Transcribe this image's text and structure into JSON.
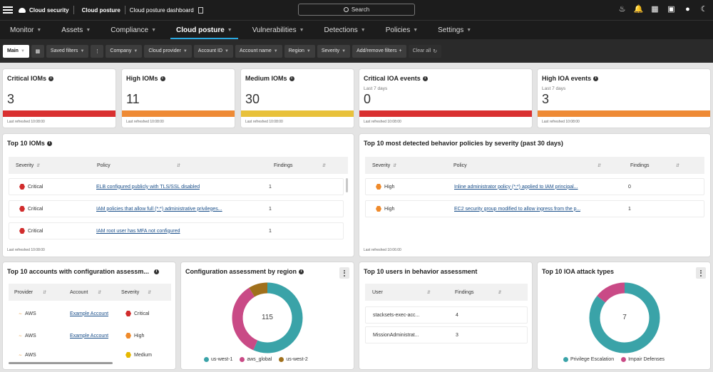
{
  "topbar": {
    "app": "Cloud security",
    "module": "Cloud posture",
    "page": "Cloud posture dashboard",
    "search_label": "Search"
  },
  "nav": {
    "tabs": [
      {
        "label": "Monitor"
      },
      {
        "label": "Assets"
      },
      {
        "label": "Compliance"
      },
      {
        "label": "Cloud posture"
      },
      {
        "label": "Vulnerabilities"
      },
      {
        "label": "Detections"
      },
      {
        "label": "Policies"
      },
      {
        "label": "Settings"
      }
    ]
  },
  "filters": {
    "view": "Main",
    "saved": "Saved filters",
    "items": [
      "Company",
      "Cloud provider",
      "Account ID",
      "Account name",
      "Region",
      "Severity"
    ],
    "add_remove": "Add/remove filters",
    "clear": "Clear all"
  },
  "kpis": [
    {
      "title": "Critical IOMs",
      "sub": "",
      "value": "3",
      "color": "#d93030",
      "refreshed": "Last refreshed 10:08:00"
    },
    {
      "title": "High IOMs",
      "sub": "",
      "value": "11",
      "color": "#ee8a35",
      "refreshed": "Last refreshed 10:08:00"
    },
    {
      "title": "Medium IOMs",
      "sub": "",
      "value": "30",
      "color": "#e8c13a",
      "refreshed": "Last refreshed 10:08:00"
    },
    {
      "title": "Critical IOA events",
      "sub": "Last 7 days",
      "value": "0",
      "color": "#d93030",
      "refreshed": "Last refreshed 10:08:00"
    },
    {
      "title": "High IOA events",
      "sub": "Last 7 days",
      "value": "3",
      "color": "#ee8a35",
      "refreshed": "Last refreshed 10:08:00"
    }
  ],
  "top_ioms": {
    "title": "Top 10 IOMs",
    "headers": {
      "severity": "Severity",
      "policy": "Policy",
      "findings": "Findings"
    },
    "rows": [
      {
        "severity": "Critical",
        "policy": "ELB configured publicly with TLS/SSL disabled",
        "findings": "1"
      },
      {
        "severity": "Critical",
        "policy": "IAM policies that allow full (*:*) administrative privileges...",
        "findings": "1"
      },
      {
        "severity": "Critical",
        "policy": "IAM root user has MFA not configured",
        "findings": "1"
      }
    ],
    "refreshed": "Last refreshed 10:08:00"
  },
  "top_behavior": {
    "title": "Top 10 most detected behavior policies by severity (past 30 days)",
    "headers": {
      "severity": "Severity",
      "policy": "Policy",
      "findings": "Findings"
    },
    "rows": [
      {
        "severity": "High",
        "policy": "Inline administrator policy (*:*) applied to IAM principal...",
        "findings": "0"
      },
      {
        "severity": "High",
        "policy": "EC2 security group modified to allow ingress from the p...",
        "findings": "1"
      }
    ],
    "refreshed": "Last refreshed 10:06:00"
  },
  "top_accounts": {
    "title": "Top 10 accounts with configuration assessm...",
    "headers": {
      "provider": "Provider",
      "account": "Account",
      "severity": "Severity"
    },
    "rows": [
      {
        "provider": "AWS",
        "account": "Example Account",
        "severity": "Critical"
      },
      {
        "provider": "AWS",
        "account": "Example Account",
        "severity": "High"
      },
      {
        "provider": "AWS",
        "account": "",
        "severity": "Medium"
      }
    ]
  },
  "region_chart": {
    "title": "Configuration assessment by region",
    "total": "115",
    "legend": [
      "us-west-1",
      "aws_global",
      "us-west-2"
    ],
    "colors": [
      "#3aa3a8",
      "#c94a86",
      "#a0701c"
    ]
  },
  "top_users": {
    "title": "Top 10 users in behavior assessment",
    "headers": {
      "user": "User",
      "findings": "Findings"
    },
    "rows": [
      {
        "user": "stacksets-exec-acc...",
        "findings": "4"
      },
      {
        "user": "MissionAdministrat...",
        "findings": "3"
      }
    ]
  },
  "ioa_chart": {
    "title": "Top 10 IOA attack types",
    "total": "7",
    "legend": [
      "Privilege Escalation",
      "Impair Defenses"
    ],
    "colors": [
      "#3aa3a8",
      "#c94a86"
    ]
  },
  "chart_data": [
    {
      "type": "pie",
      "title": "Configuration assessment by region",
      "categories": [
        "us-west-1",
        "aws_global",
        "us-west-2"
      ],
      "values": [
        65,
        40,
        10
      ],
      "total": 115
    },
    {
      "type": "pie",
      "title": "Top 10 IOA attack types",
      "categories": [
        "Privilege Escalation",
        "Impair Defenses"
      ],
      "values": [
        6,
        1
      ],
      "total": 7
    }
  ]
}
